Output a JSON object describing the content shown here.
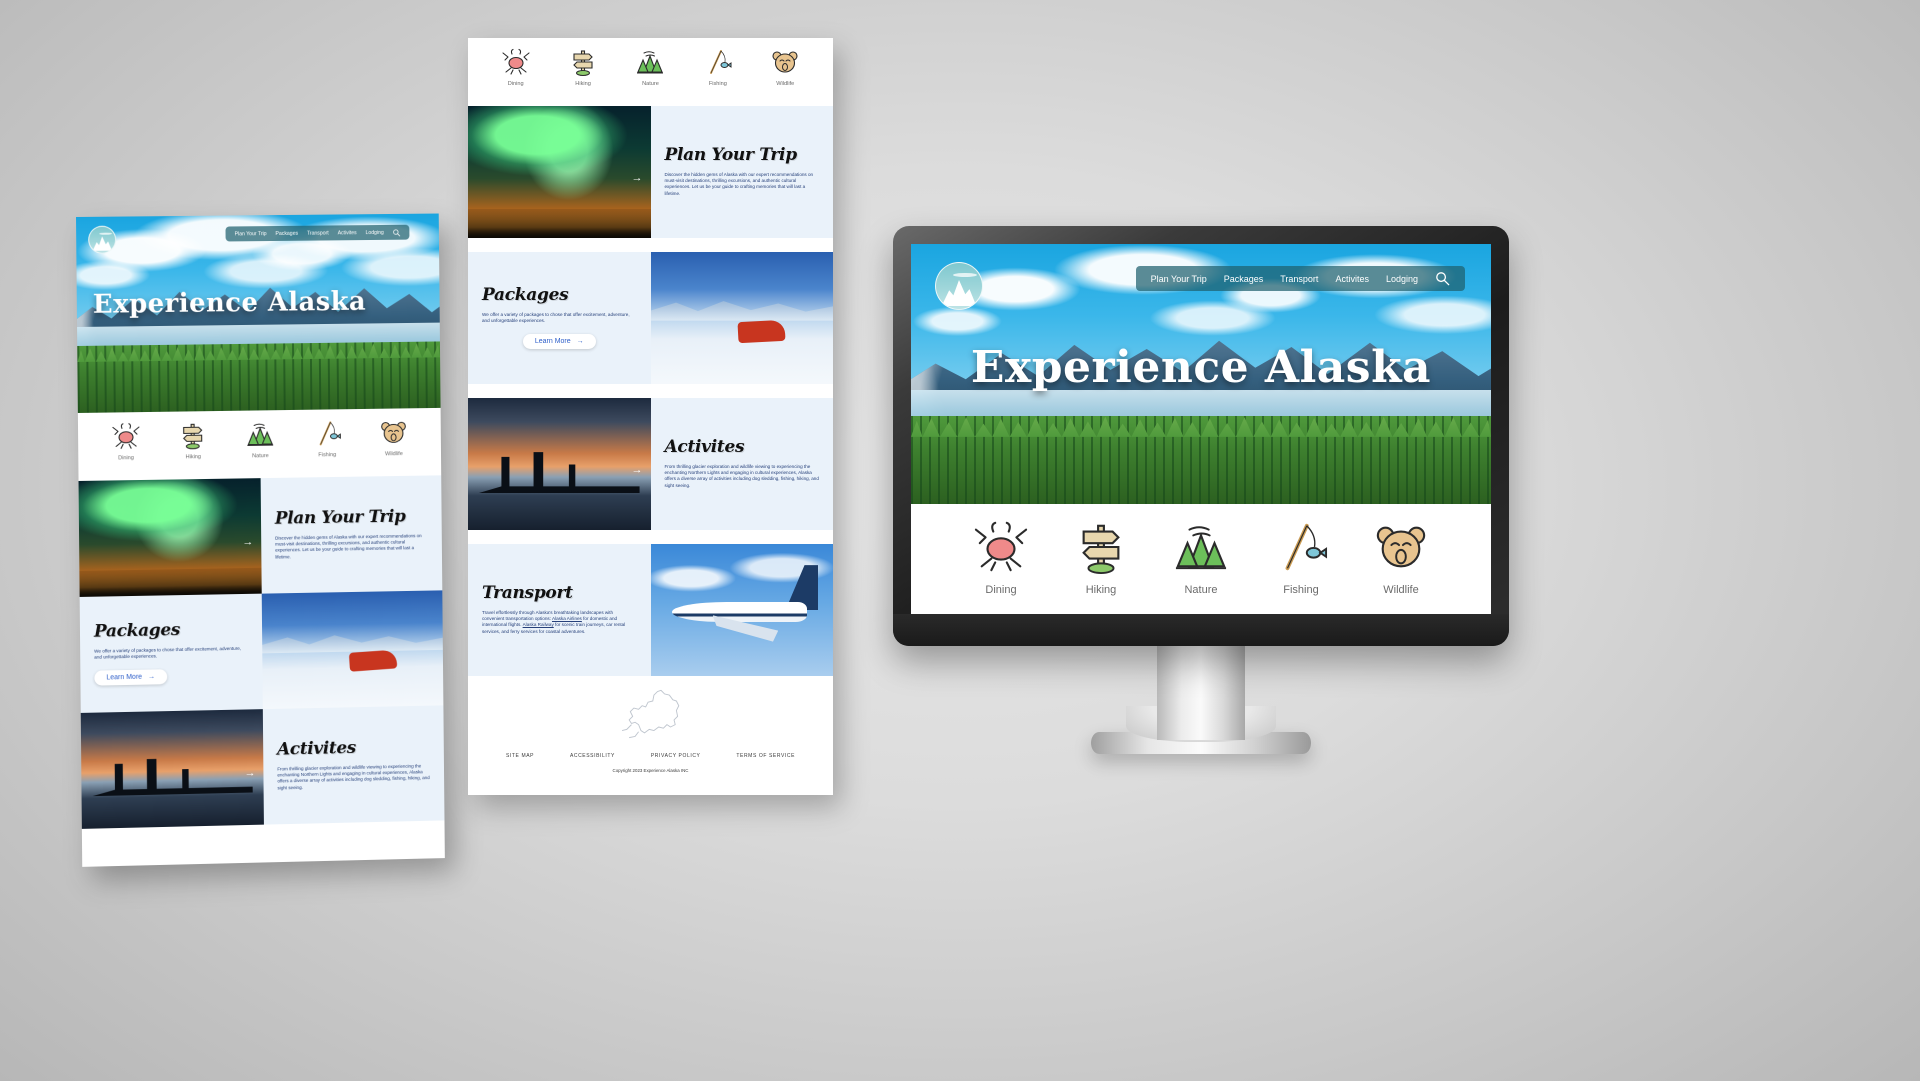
{
  "site": {
    "brand_title": "Experience Alaska",
    "logo_name": "mountain-logo"
  },
  "nav": {
    "items": [
      {
        "label": "Plan Your Trip"
      },
      {
        "label": "Packages"
      },
      {
        "label": "Transport"
      },
      {
        "label": "Activites"
      },
      {
        "label": "Lodging"
      }
    ],
    "search_icon": "search-icon",
    "background_color": "#1f5f6e"
  },
  "categories": [
    {
      "label": "Dining",
      "icon": "crab-icon",
      "color": "#ef8a8a"
    },
    {
      "label": "Hiking",
      "icon": "signpost-icon",
      "color": "#e8d7ae"
    },
    {
      "label": "Nature",
      "icon": "trees-icon",
      "color": "#6cbf5a"
    },
    {
      "label": "Fishing",
      "icon": "fishing-rod-icon",
      "color": "#7ec6d8"
    },
    {
      "label": "Wildlife",
      "icon": "bear-icon",
      "color": "#e8c48f"
    }
  ],
  "sections": [
    {
      "id": "plan-your-trip",
      "title": "Plan Your Trip",
      "body": "Discover the hidden gems of Alaska with our expert recommendations on must-visit destinations, thrilling excursions, and authentic cultural experiences. Let us be your guide to crafting memories that will last a lifetime.",
      "image": "aurora-borealis-photo",
      "arrow": "→"
    },
    {
      "id": "packages",
      "title": "Packages",
      "body": "We offer a variety of packages to chose that offer excitement, adventure, and unforgettable experiences.",
      "image": "dog-sledding-photo",
      "button_label": "Learn More",
      "button_arrow": "→"
    },
    {
      "id": "activites",
      "title": "Activites",
      "body": "From thrilling glacier exploration and wildlife viewing to experiencing the enchanting Northern Lights and engaging in cultural experiences, Alaska offers a diverse array of activities including dog sledding, fishing, hiking, and sight seeing.",
      "image": "sunset-fishing-silhouette-photo",
      "arrow": "→"
    },
    {
      "id": "transport",
      "title": "Transport",
      "body_parts": [
        {
          "text": "Travel effortlessly through Alaska's breathtaking landscapes with convenient transportation options: "
        },
        {
          "text": "Alaska Airlines",
          "link": true
        },
        {
          "text": " for domestic and international flights. "
        },
        {
          "text": "Alaska Railway",
          "link": true
        },
        {
          "text": " for scenic train journeys, car rental services, and ferry services for coastal adventures."
        }
      ],
      "image": "alaska-airlines-plane-photo"
    }
  ],
  "footer": {
    "map_icon": "alaska-map-outline",
    "links": [
      "SITE MAP",
      "ACCESSIBILITY",
      "PRIVACY POLICY",
      "TERMS OF SERVICE"
    ],
    "copyright": "Copyright 2023 Experience Alaska INC"
  }
}
